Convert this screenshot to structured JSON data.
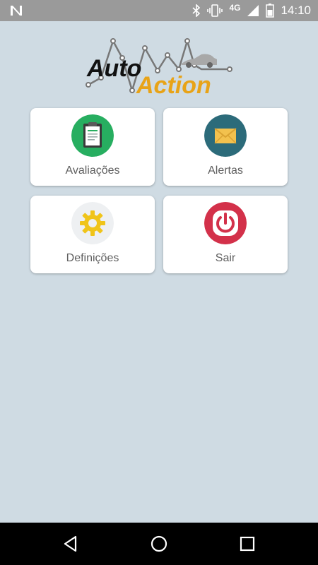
{
  "status_bar": {
    "time": "14:10",
    "network": "4G",
    "icons": [
      "notification-n-icon",
      "bluetooth-icon",
      "vibrate-icon",
      "signal-icon",
      "battery-icon"
    ]
  },
  "logo": {
    "word1": "Auto",
    "word2": "Action",
    "accent_color": "#e8a317"
  },
  "menu": {
    "items": [
      {
        "label": "Avaliações",
        "icon": "clipboard-icon",
        "color": "#27ae60"
      },
      {
        "label": "Alertas",
        "icon": "envelope-icon",
        "color": "#2c6b7a"
      },
      {
        "label": "Definições",
        "icon": "gear-icon",
        "color": "#f0c419"
      },
      {
        "label": "Sair",
        "icon": "power-icon",
        "color": "#d3314a"
      }
    ]
  },
  "nav_bar": {
    "buttons": [
      "back-icon",
      "home-icon",
      "recents-icon"
    ]
  }
}
